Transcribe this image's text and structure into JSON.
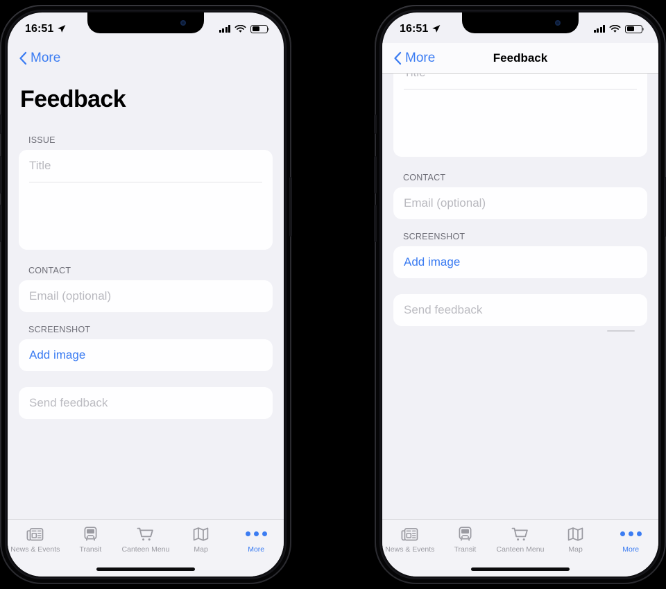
{
  "status_bar": {
    "time": "16:51",
    "location_icon": "location-arrow-icon",
    "signal_icon": "cellular-signal-icon",
    "wifi_icon": "wifi-icon",
    "battery_icon": "battery-icon",
    "battery_level_percent": 52
  },
  "colors": {
    "accent_blue": "#3b7cf2",
    "page_background": "#f1f1f6",
    "card_background": "#fefeff",
    "tabbar_background": "#f3f3f7",
    "section_label": "#6d6d76",
    "placeholder": "#b9b9bf",
    "disabled": "#bcbcc2"
  },
  "left_phone": {
    "nav": {
      "back_label": "More",
      "back_icon": "chevron-left-icon",
      "title": ""
    },
    "large_title": "Feedback",
    "sections": {
      "issue": {
        "label": "ISSUE",
        "title_placeholder": "Title",
        "body_value": ""
      },
      "contact": {
        "label": "CONTACT",
        "email_placeholder": "Email (optional)"
      },
      "screenshot": {
        "label": "SCREENSHOT",
        "add_image_label": "Add image"
      }
    },
    "submit": {
      "label": "Send feedback",
      "enabled": false
    }
  },
  "right_phone": {
    "nav": {
      "back_label": "More",
      "back_icon": "chevron-left-icon",
      "title": "Feedback"
    },
    "sections": {
      "issue": {
        "title_placeholder": "Title",
        "body_value": ""
      },
      "contact": {
        "label": "CONTACT",
        "email_placeholder": "Email (optional)"
      },
      "screenshot": {
        "label": "SCREENSHOT",
        "add_image_label": "Add image"
      }
    },
    "submit": {
      "label": "Send feedback",
      "enabled": false
    }
  },
  "tab_bar": {
    "items": [
      {
        "label": "News & Events",
        "icon": "newspaper-icon",
        "active": false
      },
      {
        "label": "Transit",
        "icon": "bus-icon",
        "active": false
      },
      {
        "label": "Canteen Menu",
        "icon": "shopping-cart-icon",
        "active": false
      },
      {
        "label": "Map",
        "icon": "map-icon",
        "active": false
      },
      {
        "label": "More",
        "icon": "ellipsis-icon",
        "active": true
      }
    ]
  }
}
